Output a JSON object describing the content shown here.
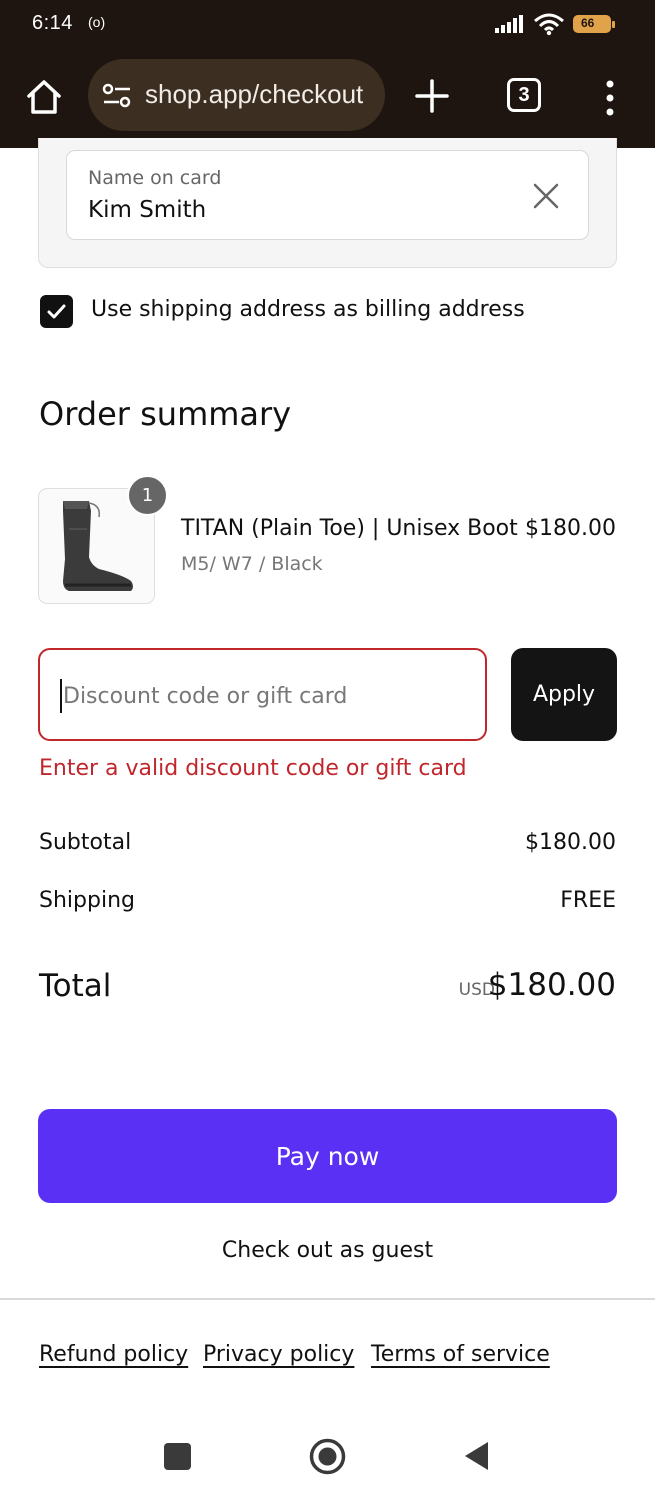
{
  "status_bar": {
    "time": "6:14",
    "radio_indicator": "(o)",
    "battery_level": "66",
    "icons": [
      "signal-icon",
      "wifi-icon",
      "battery-icon"
    ]
  },
  "browser": {
    "url": "shop.app/checkout",
    "tab_count": "3",
    "icons": [
      "home-icon",
      "site-settings-icon",
      "plus-icon",
      "more-vert-icon"
    ],
    "theme_color": "#1f1510"
  },
  "billing": {
    "name_on_card_label": "Name on card",
    "name_on_card_value": "Kim Smith",
    "use_shipping_label": "Use shipping address as billing address",
    "use_shipping_checked": true
  },
  "order_summary": {
    "title": "Order summary",
    "items": [
      {
        "quantity": "1",
        "name": "TITAN (Plain Toe) | Unisex Boot",
        "variant": "M5/ W7 / Black",
        "price": "$180.00"
      }
    ],
    "discount": {
      "placeholder": "Discount code or gift card",
      "value": "",
      "apply_label": "Apply",
      "error": "Enter a valid discount code or gift card",
      "error_color": "#c0272d"
    },
    "subtotal_label": "Subtotal",
    "subtotal_value": "$180.00",
    "shipping_label": "Shipping",
    "shipping_value": "FREE",
    "total_label": "Total",
    "currency": "USD",
    "total_value": "$180.00"
  },
  "actions": {
    "pay_label": "Pay now",
    "pay_color": "#5a31f4",
    "guest_label": "Check out as guest"
  },
  "footer": {
    "links": [
      "Refund policy",
      "Privacy policy",
      "Terms of service"
    ]
  },
  "system_nav": {
    "icons": [
      "recents-icon",
      "home-circle-icon",
      "back-icon"
    ]
  }
}
